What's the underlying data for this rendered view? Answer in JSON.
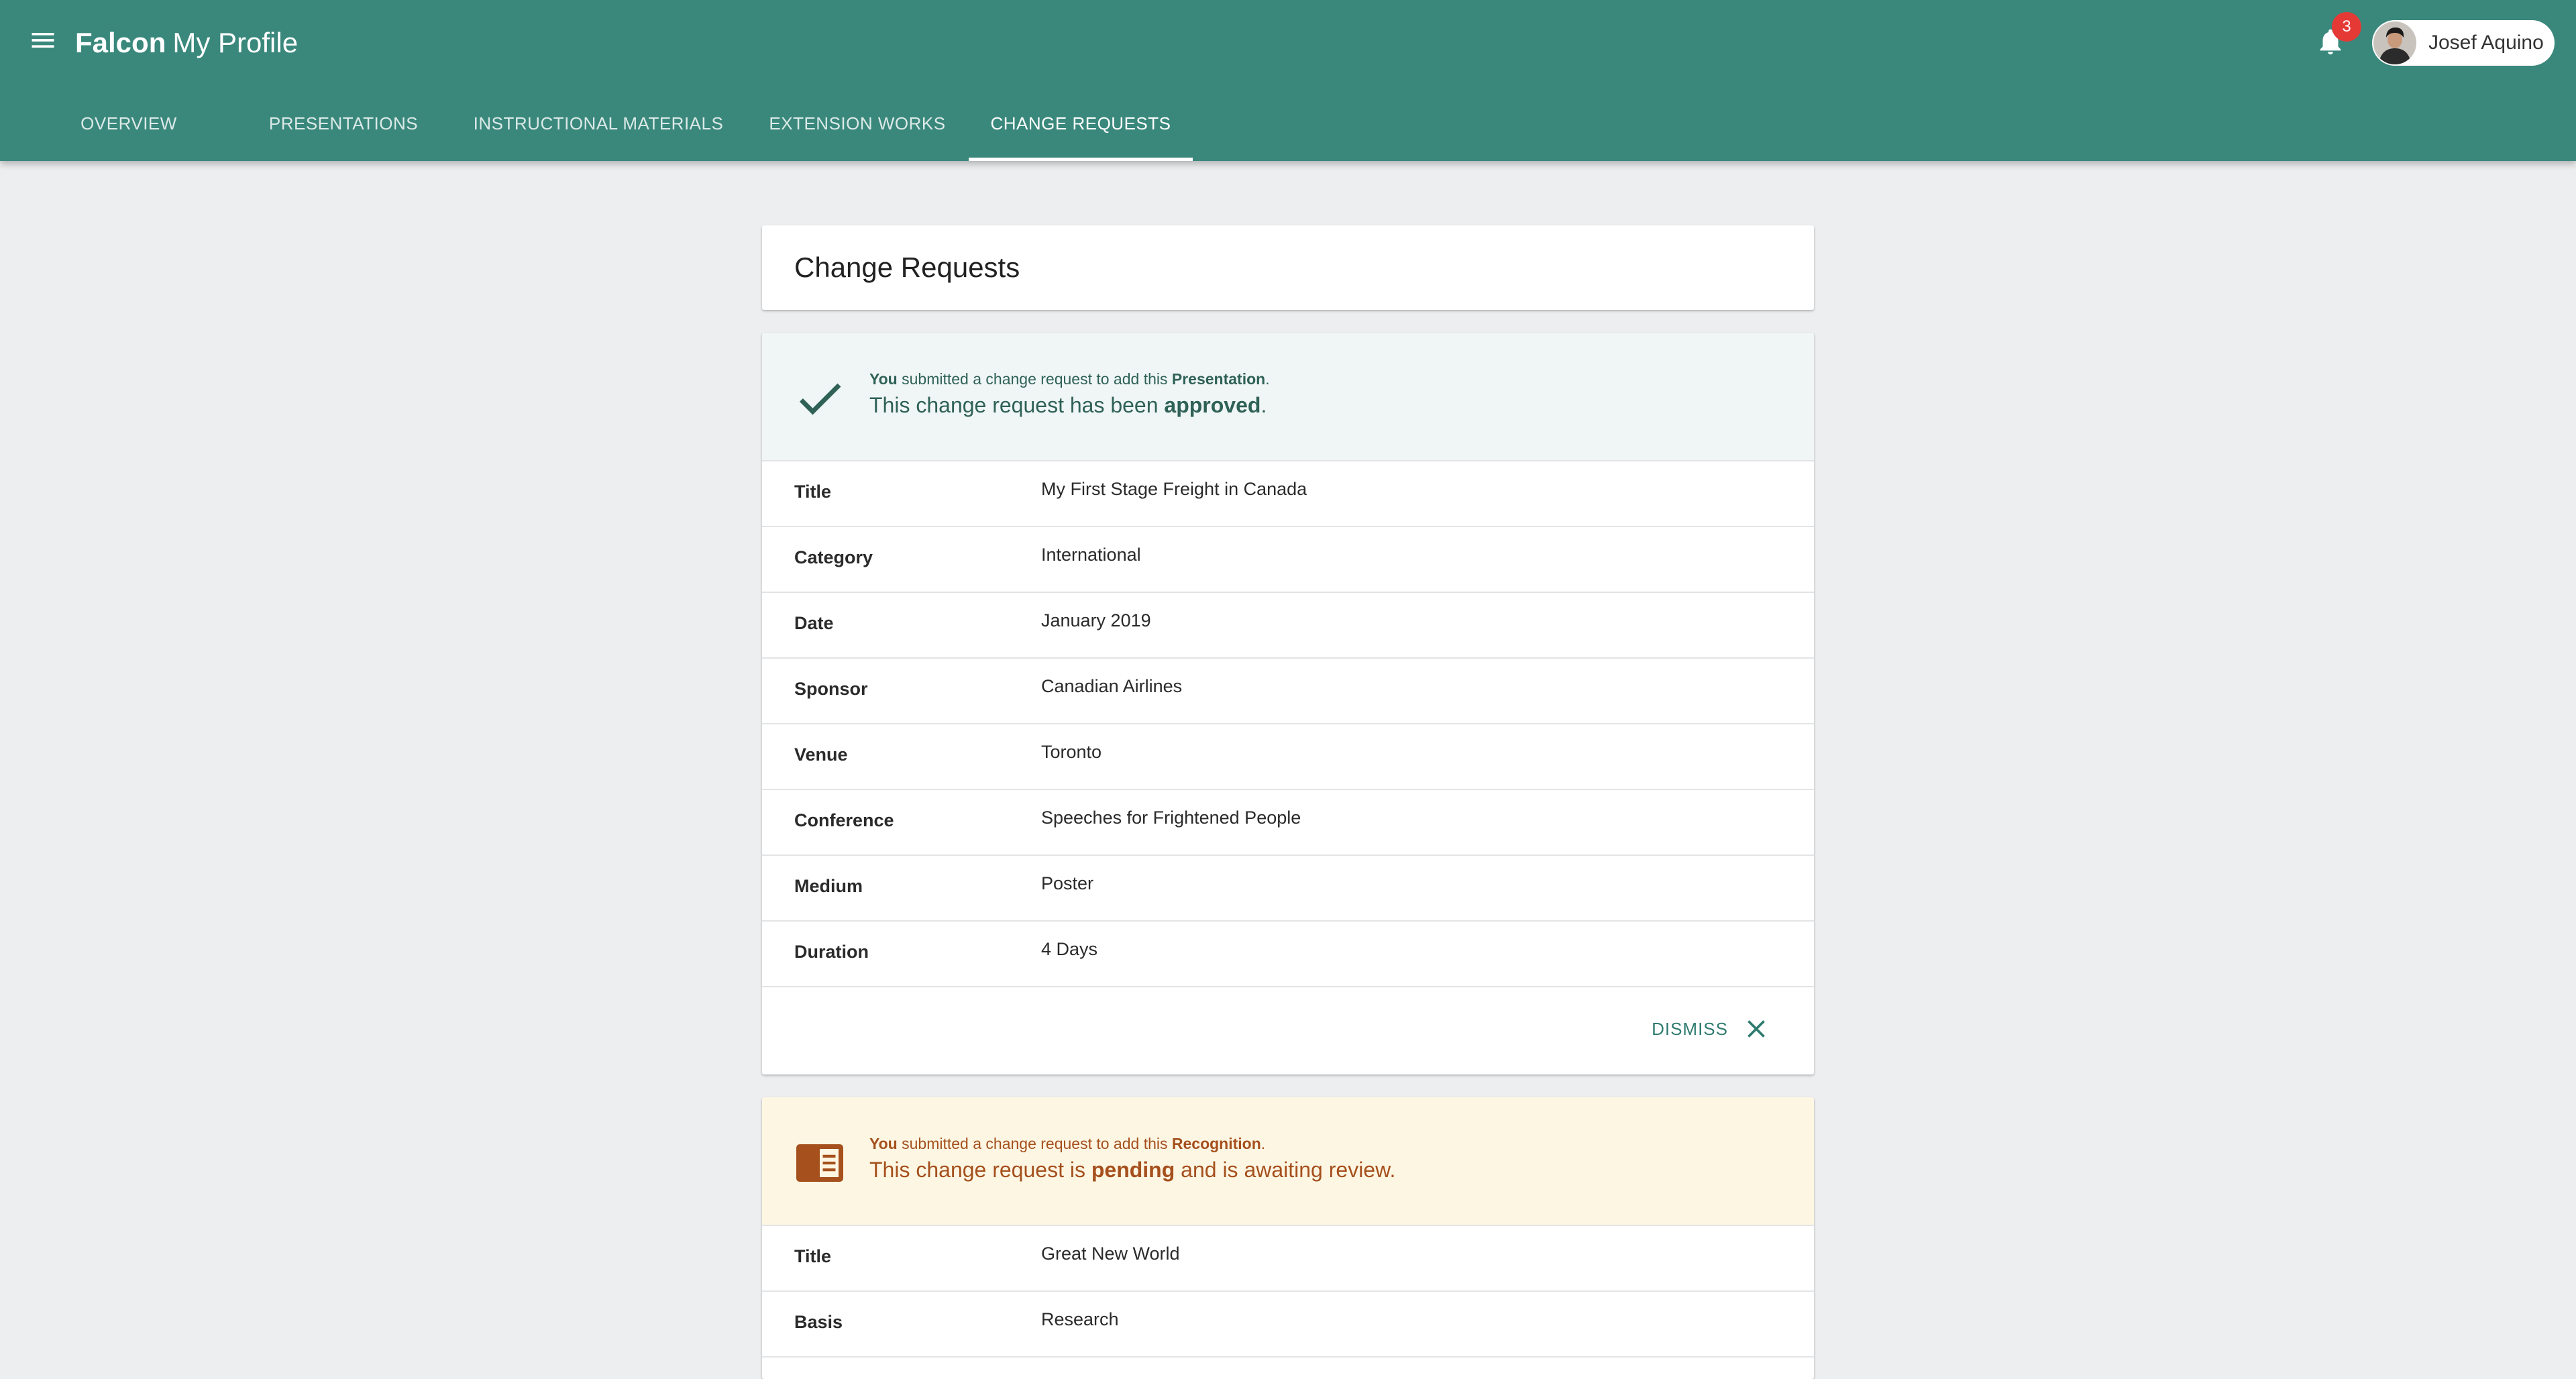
{
  "app": {
    "brand": "Falcon",
    "product": "My Profile"
  },
  "header": {
    "notification_count": "3",
    "user_name": "Josef Aquino"
  },
  "tabs": [
    {
      "label": "Overview",
      "active": false
    },
    {
      "label": "Presentations",
      "active": false
    },
    {
      "label": "Instructional Materials",
      "active": false
    },
    {
      "label": "Extension Works",
      "active": false
    },
    {
      "label": "Change Requests",
      "active": true
    }
  ],
  "page": {
    "title": "Change Requests"
  },
  "requests": [
    {
      "status": "approved",
      "status_color": "#2f6157",
      "banner_color": "#eff6f5",
      "icon": "check-icon",
      "actor": "You",
      "line1_text": "submitted a change request to add this",
      "item_type": "Presentation",
      "line2_prefix": "This change request has been",
      "status_word": "approved",
      "line2_suffix": ".",
      "fields": [
        {
          "label": "Title",
          "value": "My First Stage Freight in Canada"
        },
        {
          "label": "Category",
          "value": "International"
        },
        {
          "label": "Date",
          "value": "January 2019"
        },
        {
          "label": "Sponsor",
          "value": "Canadian Airlines"
        },
        {
          "label": "Venue",
          "value": "Toronto"
        },
        {
          "label": "Conference",
          "value": "Speeches for Frightened People"
        },
        {
          "label": "Medium",
          "value": "Poster"
        },
        {
          "label": "Duration",
          "value": "4 Days"
        }
      ],
      "dismiss_label": "Dismiss"
    },
    {
      "status": "pending",
      "status_color": "#a5501d",
      "banner_color": "#fdf6e3",
      "icon": "recognition-card-icon",
      "actor": "You",
      "line1_text": "submitted a change request to add this",
      "item_type": "Recognition",
      "line2_prefix": "This change request is",
      "status_word": "pending",
      "line2_suffix": "and is awaiting review.",
      "fields": [
        {
          "label": "Title",
          "value": "Great New World"
        },
        {
          "label": "Basis",
          "value": "Research"
        }
      ]
    }
  ],
  "colors": {
    "appbar": "#3a887c",
    "accent": "#2f7b70",
    "page_background": "#eceef0",
    "badge": "#e53935"
  }
}
